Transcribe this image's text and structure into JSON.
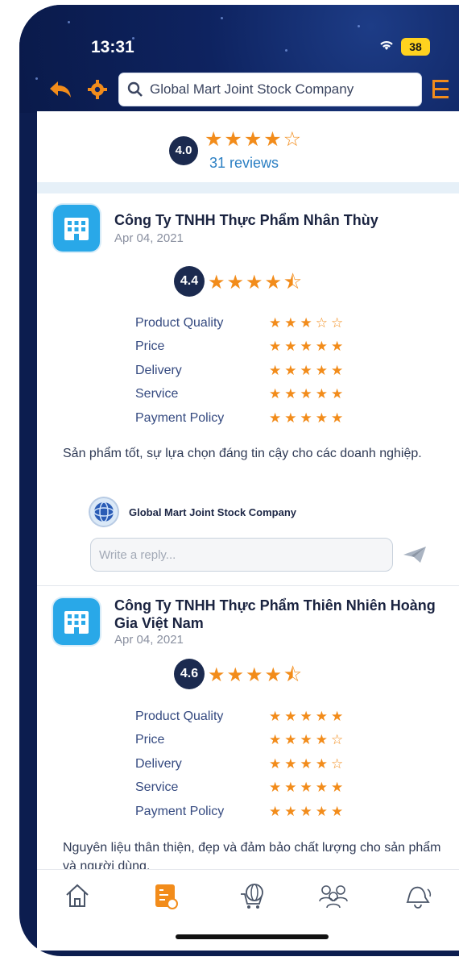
{
  "status_bar": {
    "time": "13:31",
    "battery": "38"
  },
  "toolbar": {
    "search_text": "Global Mart Joint Stock Company"
  },
  "summary": {
    "rating": "4.0",
    "stars": "★★★★☆",
    "reviews": "31 reviews"
  },
  "reviews": [
    {
      "company": "Công Ty TNHH Thực Phẩm Nhân Thùy",
      "date": "Apr 04, 2021",
      "rating": "4.4",
      "stars": "★★★★⯪",
      "criteria": [
        {
          "label": "Product Quality",
          "stars": "★★★☆☆"
        },
        {
          "label": "Price",
          "stars": "★★★★★"
        },
        {
          "label": "Delivery",
          "stars": "★★★★★"
        },
        {
          "label": "Service",
          "stars": "★★★★★"
        },
        {
          "label": "Payment Policy",
          "stars": "★★★★★"
        }
      ],
      "comment": "Sản phẩm tốt, sự lựa chọn đáng tin cậy cho các doanh nghiệp.",
      "reply_company": "Global Mart Joint Stock Company",
      "reply_placeholder": "Write a reply..."
    },
    {
      "company": "Công Ty TNHH Thực Phẩm Thiên Nhiên Hoàng Gia Việt Nam",
      "date": "Apr 04, 2021",
      "rating": "4.6",
      "stars": "★★★★⯪",
      "criteria": [
        {
          "label": "Product Quality",
          "stars": "★★★★★"
        },
        {
          "label": "Price",
          "stars": "★★★★☆"
        },
        {
          "label": "Delivery",
          "stars": "★★★★☆"
        },
        {
          "label": "Service",
          "stars": "★★★★★"
        },
        {
          "label": "Payment Policy",
          "stars": "★★★★★"
        }
      ],
      "comment": "Nguyên liệu thân thiện, đẹp và đảm bảo chất lượng cho sản phẩm và người dùng."
    }
  ],
  "colors": {
    "accent": "#f28c1b",
    "navy": "#0c1d4f",
    "link": "#2b7fc3"
  }
}
